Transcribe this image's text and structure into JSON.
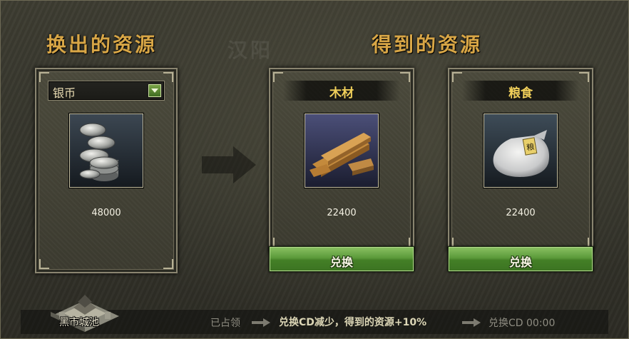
{
  "watermark": "汉阳",
  "left_section": {
    "title": "换出的资源"
  },
  "right_section": {
    "title": "得到的资源"
  },
  "source": {
    "selected": "银币",
    "icon": "silver-coins-icon",
    "amount": "48000"
  },
  "targets": [
    {
      "name": "木材",
      "icon": "wood-planks-icon",
      "amount": "22400",
      "button": "兑换"
    },
    {
      "name": "粮食",
      "icon": "grain-sack-icon",
      "amount": "22400",
      "button": "兑换"
    }
  ],
  "footer": {
    "city": "黑市城池",
    "occupied": "已占领",
    "bonus": "兑换CD减少，得到的资源+10%",
    "cd": "兑换CD 00:00"
  },
  "colors": {
    "title_gold": "#d8a646",
    "name_yellow": "#f0cf5a",
    "button_green": "#5b9a3a"
  }
}
